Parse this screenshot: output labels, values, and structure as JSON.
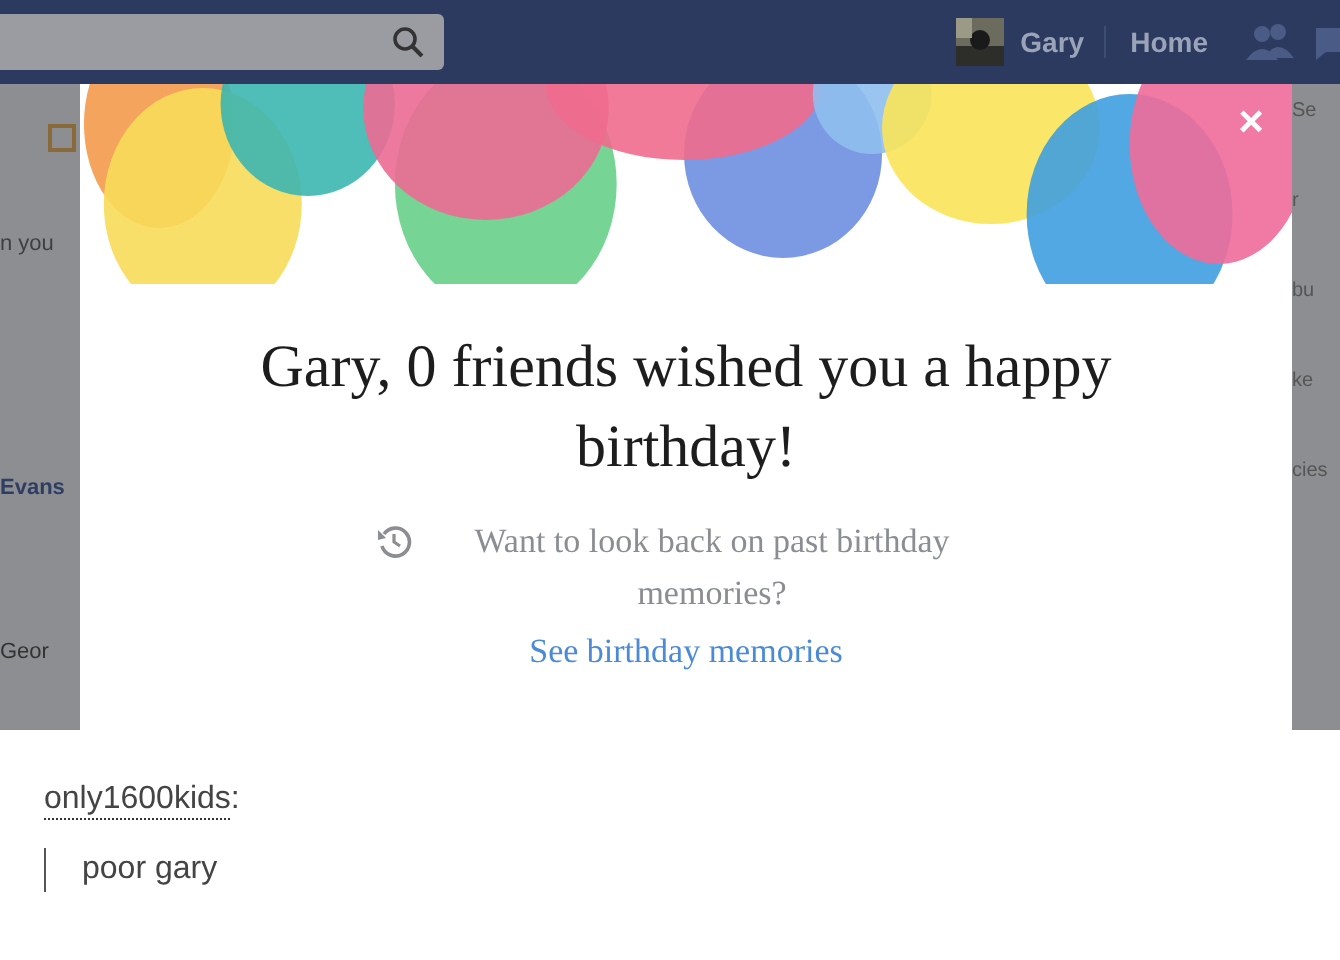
{
  "screenshot": {
    "header": {
      "profile_name": "Gary",
      "nav": [
        "Home"
      ]
    },
    "background_left": [
      "n you",
      "Evans",
      "Geor"
    ],
    "background_right": [
      "Se",
      "r",
      "bu",
      "ke",
      "cies"
    ],
    "modal": {
      "close": "×",
      "title": "Gary, 0 friends wished you a happy birthday!",
      "prompt": "Want to look back on past birthday memories?",
      "link": "See birthday memories"
    }
  },
  "post": {
    "username": "only1600kids",
    "separator": ":",
    "quote": "poor gary"
  }
}
